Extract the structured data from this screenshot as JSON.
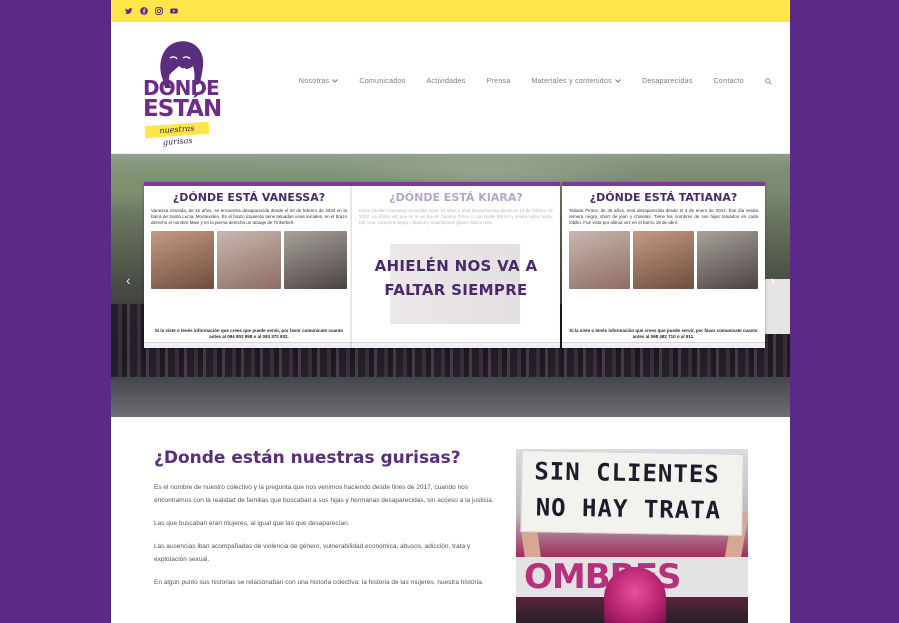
{
  "topbar": {
    "social": [
      {
        "name": "twitter-icon"
      },
      {
        "name": "facebook-icon"
      },
      {
        "name": "instagram-icon"
      },
      {
        "name": "youtube-icon"
      }
    ]
  },
  "logo": {
    "line1": "DÓNDE",
    "line2": "ESTÁN",
    "tagline": "nuestras gurisas"
  },
  "nav": {
    "items": [
      {
        "label": "Nosotras",
        "dropdown": true
      },
      {
        "label": "Comunicados",
        "dropdown": false
      },
      {
        "label": "Actividades",
        "dropdown": false
      },
      {
        "label": "Prensa",
        "dropdown": false
      },
      {
        "label": "Materiales y contenidos",
        "dropdown": true
      },
      {
        "label": "Desaparecidas",
        "dropdown": false
      },
      {
        "label": "Contacto",
        "dropdown": false
      }
    ]
  },
  "hero": {
    "posters": [
      {
        "title": "¿DÓNDE ESTÁ VANESSA?",
        "text": "Vanessa Almeida, de 32 años, se encuentra desaparecida desde el 20 de febrero de 2022 en la barra de Santa Lucía, Montevideo. En el brazo izquierdo tiene tatuadas unas iniciales, en el brazo derecho el nombre Maxi y en la pierna derecha un tatuaje de Tinkerbell.",
        "footer": "Si la viste o tenés información que crees que puede servir, por favor comunicate cuanto antes al 094 902 958 o al 093 372 932."
      },
      {
        "title": "¿DÓNDE ESTÁ KIARA?",
        "text": "Kiara Ahielén Casavieja González tiene 15 años y está desaparecida desde el 12 de febrero de 2022. La última vez que se la vio fue en Camino Pzuru y Luis Batlle Berres y vestía calza negra, top rosa, campera negra y blanca y championes grises marca Nike.",
        "overlay_line1": "AHIELÉN NOS VA A",
        "overlay_line2": "FALTAR SIEMPRE"
      },
      {
        "title": "¿DÓNDE ESTÁ TATIANA?",
        "text": "Tatiana Pintos, de 35 años, está desaparecida desde el 3 de enero de 2022. Ese día vestía remera negra, short de jean y chinelas. Tiene los nombres de sus hijas tatuados en cada tobillo. Fue vista por última vez en el barrio 18 de abril.",
        "footer": "Si la viste o tenés información que crees que puede servir, por favor comunicate cuanto antes al 098 482 710 o al 911."
      }
    ]
  },
  "content": {
    "heading": "¿Donde están nuestras gurisas?",
    "paragraphs": [
      "Es el nombre de nuestro colectivo y la pregunta que nos venimos haciendo desde fines de 2017, cuando nos encontramos con la realidad de familias que buscaban a sus hijas y hermanas desaparecidas, sin acceso a la justicia.",
      "Las que buscaban eran mujeres, al igual que las que desaparecían.",
      "Las ausencias iban acompañadas de violencia de género, vulnerabilidad económica, abusos, adicción, trata y explotación sexual.",
      "En algún punto sus historias se relacionaban con una historia colectiva: la historia de las mujeres, nuestra historia."
    ],
    "photo": {
      "sign_line1": "SIN CLIENTES",
      "sign_line2": "NO HAY TRATA",
      "banner_text": "OMBRES"
    }
  }
}
